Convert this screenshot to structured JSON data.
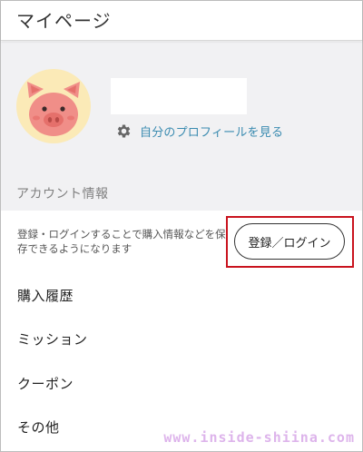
{
  "header": {
    "title": "マイページ"
  },
  "profile": {
    "avatar_icon": "pig-face-icon",
    "profile_link_icon": "gear-icon",
    "profile_link_label": "自分のプロフィールを見る"
  },
  "account": {
    "section_title": "アカウント情報",
    "login_description": "登録・ログインすることで購入情報などを保存できるようになります",
    "login_button_label": "登録／ログイン"
  },
  "menu": {
    "items": [
      {
        "label": "購入履歴"
      },
      {
        "label": "ミッション"
      },
      {
        "label": "クーポン"
      },
      {
        "label": "その他"
      }
    ]
  },
  "watermark": "www.inside-shiina.com",
  "colors": {
    "link": "#3a8bb0",
    "highlight": "#c9131e",
    "background_gray": "#f1f1f3",
    "avatar_bg": "#fbeab7",
    "pig_pink": "#f08e88"
  }
}
